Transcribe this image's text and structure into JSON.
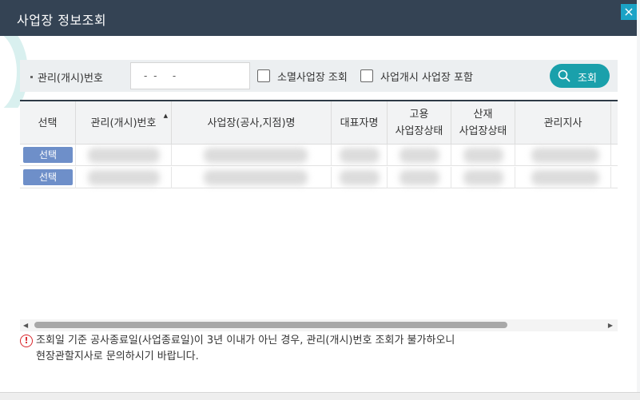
{
  "dialog": {
    "title": "사업장 정보조회",
    "close_label": "×"
  },
  "search": {
    "label": "관리(개시)번호",
    "input_value": "- -   -",
    "checkbox_closed_label": "소멸사업장 조회",
    "checkbox_closed_checked": false,
    "checkbox_started_label": "사업개시 사업장 포함",
    "checkbox_started_checked": false,
    "button_label": "조회"
  },
  "grid": {
    "columns": [
      {
        "label": "선택"
      },
      {
        "label": "관리(개시)번호",
        "sort": "ascending"
      },
      {
        "label": "사업장(공사,지점)명"
      },
      {
        "label": "대표자명"
      },
      {
        "label": "고용 사업장상태",
        "line1": "고용",
        "line2": "사업장상태"
      },
      {
        "label": "산재 사업장상태",
        "line1": "산재",
        "line2": "사업장상태"
      },
      {
        "label": "관리지사"
      }
    ],
    "rows": [
      {
        "select_label": "선택"
      },
      {
        "select_label": "선택"
      }
    ]
  },
  "notice": {
    "icon": "exclamation-circle-icon",
    "line1": "조회일 기준 공사종료일(사업종료일)이 3년 이내가 아닌 경우, 관리(개시)번호 조회가 불가하오니",
    "line2": "현장관할지사로 문의하시기 바랍니다."
  },
  "colors": {
    "title_bar": "#344354",
    "close_button": "#1ba3c6",
    "search_button": "#1aa0ab",
    "select_button": "#6e8fc9",
    "warning": "#d9262c"
  }
}
